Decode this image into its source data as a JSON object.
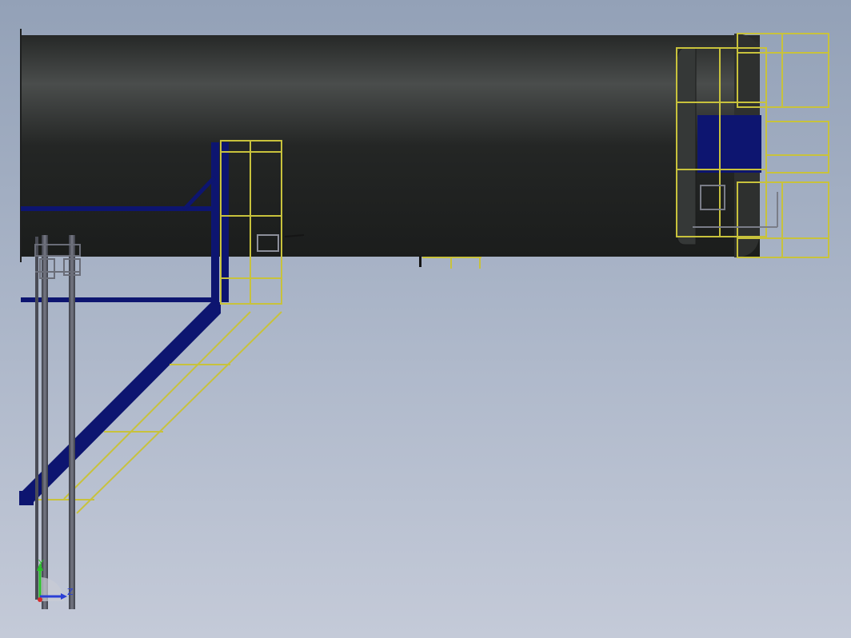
{
  "view": {
    "colors": {
      "background_top": "#93a1b7",
      "background_bottom": "#c4cad8",
      "vessel_body": "#2a2d2c",
      "structural_steel": "#0d1570",
      "handrail": "#c8c23c",
      "pipe": "#5a5c66"
    }
  },
  "triad": {
    "y_label": "Y",
    "z_label": "Z",
    "y_color": "#2bbf2b",
    "z_color": "#2b3fd6",
    "x_color": "#d62b2b"
  }
}
